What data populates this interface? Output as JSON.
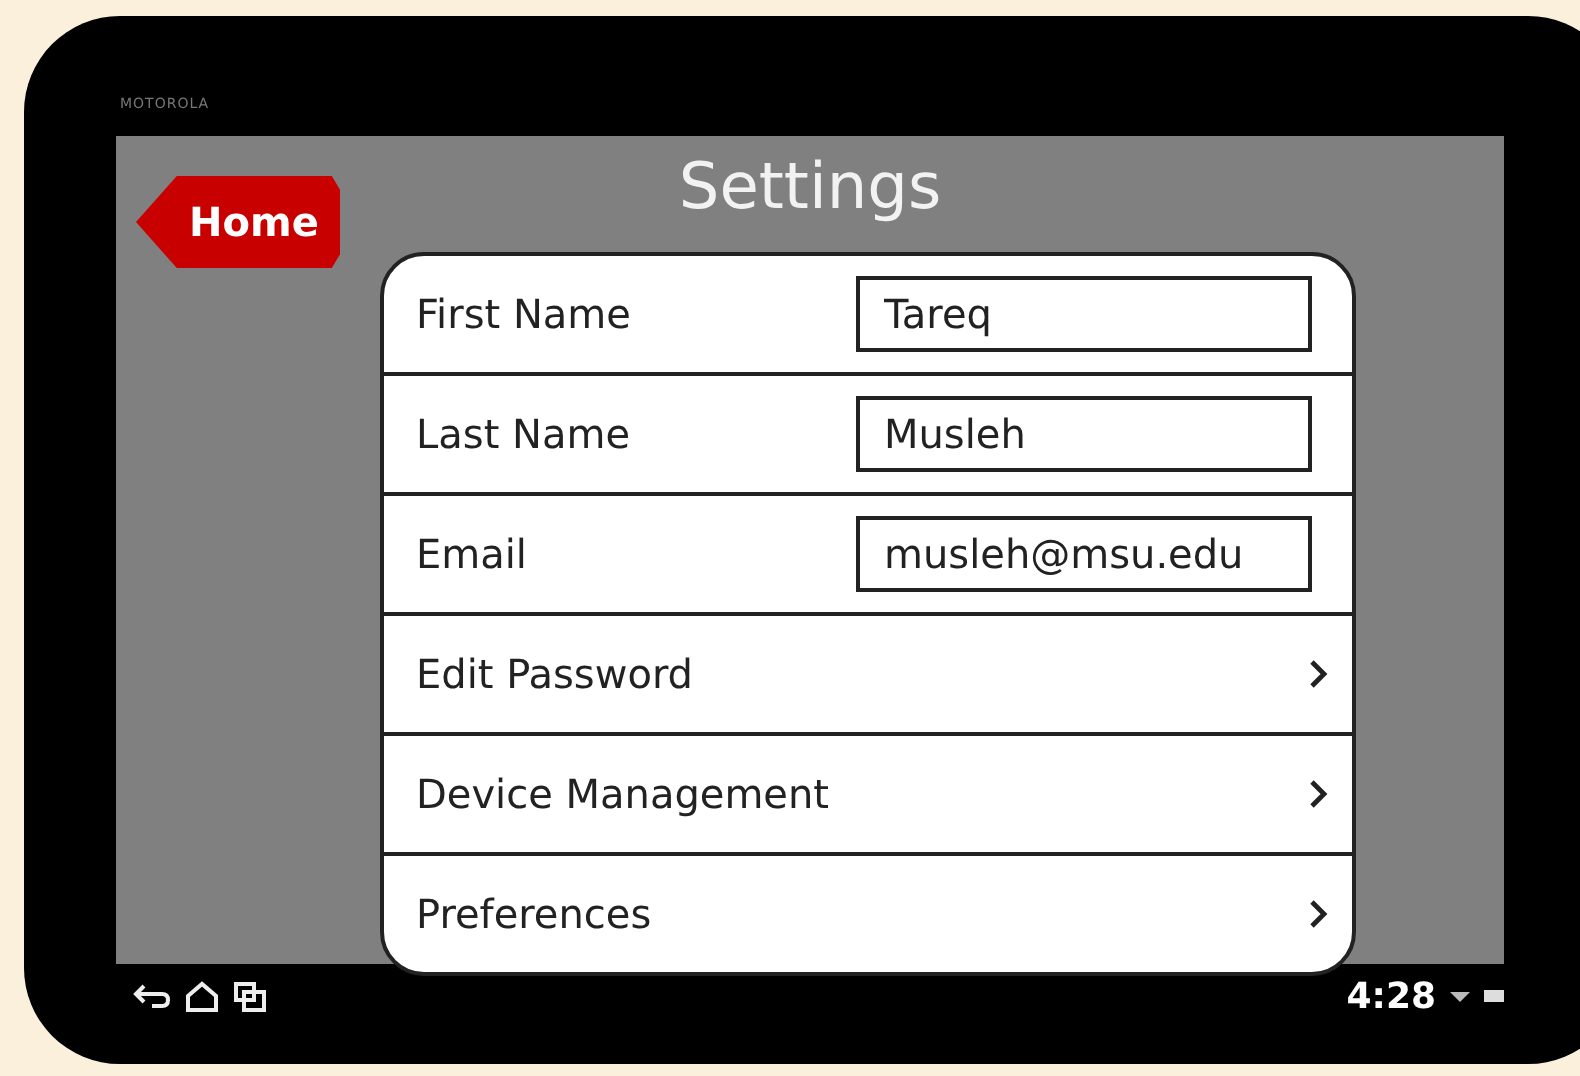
{
  "device": {
    "brand": "MOTOROLA"
  },
  "header": {
    "title": "Settings",
    "back_button": "Home"
  },
  "rows": [
    {
      "kind": "field",
      "label": "First Name",
      "value": "Tareq"
    },
    {
      "kind": "field",
      "label": "Last Name",
      "value": "Musleh"
    },
    {
      "kind": "field",
      "label": "Email",
      "value": "musleh@msu.edu"
    },
    {
      "kind": "link",
      "label": "Edit Password"
    },
    {
      "kind": "link",
      "label": "Device Management"
    },
    {
      "kind": "link",
      "label": "Preferences"
    }
  ],
  "system_bar": {
    "time": "4:28"
  }
}
